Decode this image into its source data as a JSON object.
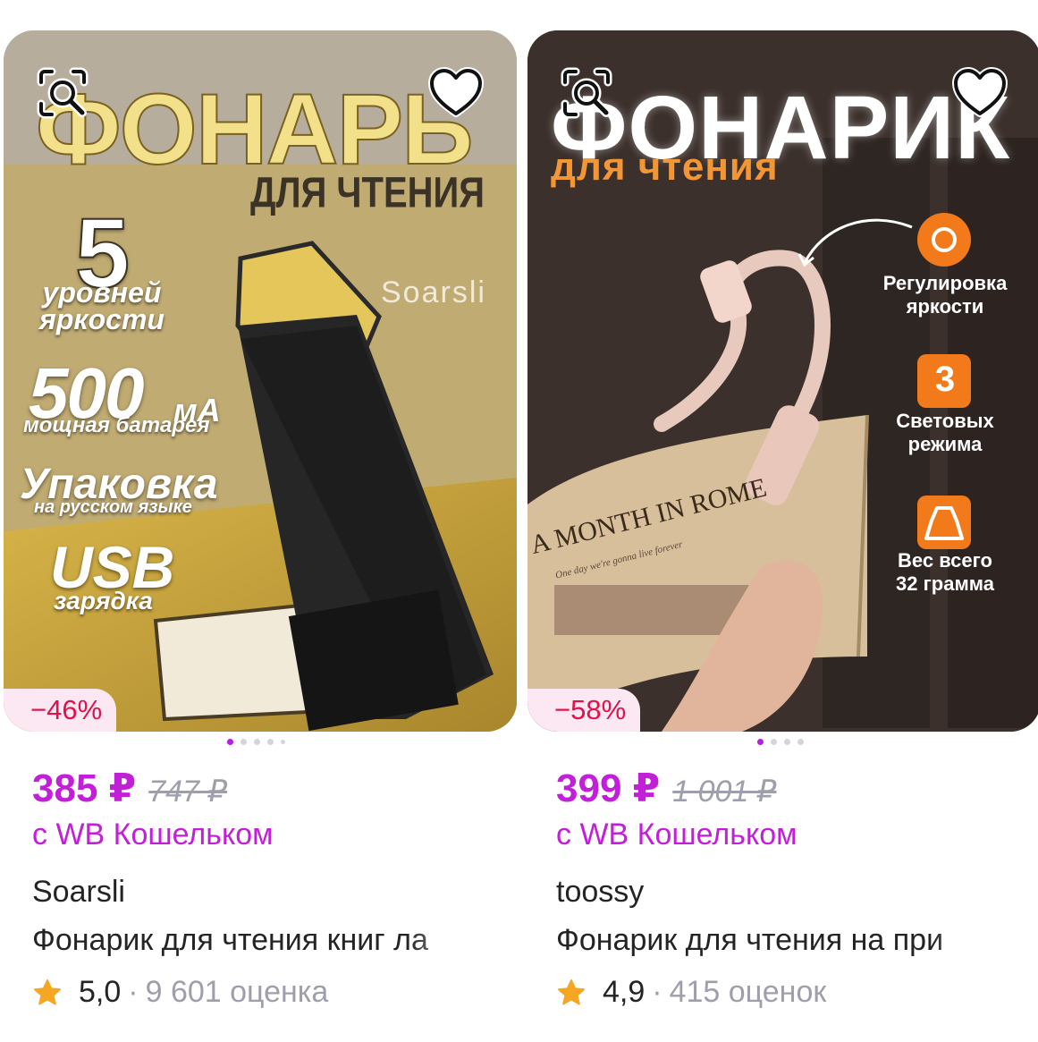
{
  "products": [
    {
      "image_text": {
        "title": "ФОНАРЬ",
        "subtitle": "ДЛЯ ЧТЕНИЯ",
        "five": "5",
        "levels": "уровней\nяркости",
        "brand_mark": "Soarsli",
        "capacity": "500",
        "capacity_unit": "мА",
        "battery": "мощная батарея",
        "pack": "Упаковка",
        "pack_sub": "на русском языке",
        "usb": "USB",
        "charge": "зарядка"
      },
      "discount": "−46%",
      "price": "385 ₽",
      "old_price": "747 ₽",
      "wallet_note": "с WB Кошельком",
      "brand": "Soarsli",
      "title": "Фонарик для чтения книг ла",
      "rating": "5,0",
      "reviews": "9 601 оценка",
      "slides": 5,
      "active_slide": 1
    },
    {
      "image_text": {
        "title": "ФОНАРИК",
        "subtitle": "для чтения",
        "feature1": "Регулировка\nяркости",
        "feature2_num": "3",
        "feature2": "Световых\nрежима",
        "feature3": "Вес всего\n32 грамма",
        "book_title": "A MONTH IN ROME",
        "book_sub": "One day we're gonna live forever"
      },
      "discount": "−58%",
      "price": "399 ₽",
      "old_price": "1 001 ₽",
      "wallet_note": "с WB Кошельком",
      "brand": "toossy",
      "title": "Фонарик для чтения на при",
      "rating": "4,9",
      "reviews": "415 оценок",
      "slides": 4,
      "active_slide": 1
    }
  ],
  "colors": {
    "accent": "#c21fd9",
    "discount_text": "#e3114a",
    "discount_bg": "#fbe8f2",
    "muted": "#9f9fab",
    "text": "#242424",
    "star": "#f5a623",
    "feature_orange": "#f27a1a"
  },
  "icons": {
    "search": "image-search-icon",
    "favorite": "heart-icon",
    "rating": "star-icon"
  }
}
